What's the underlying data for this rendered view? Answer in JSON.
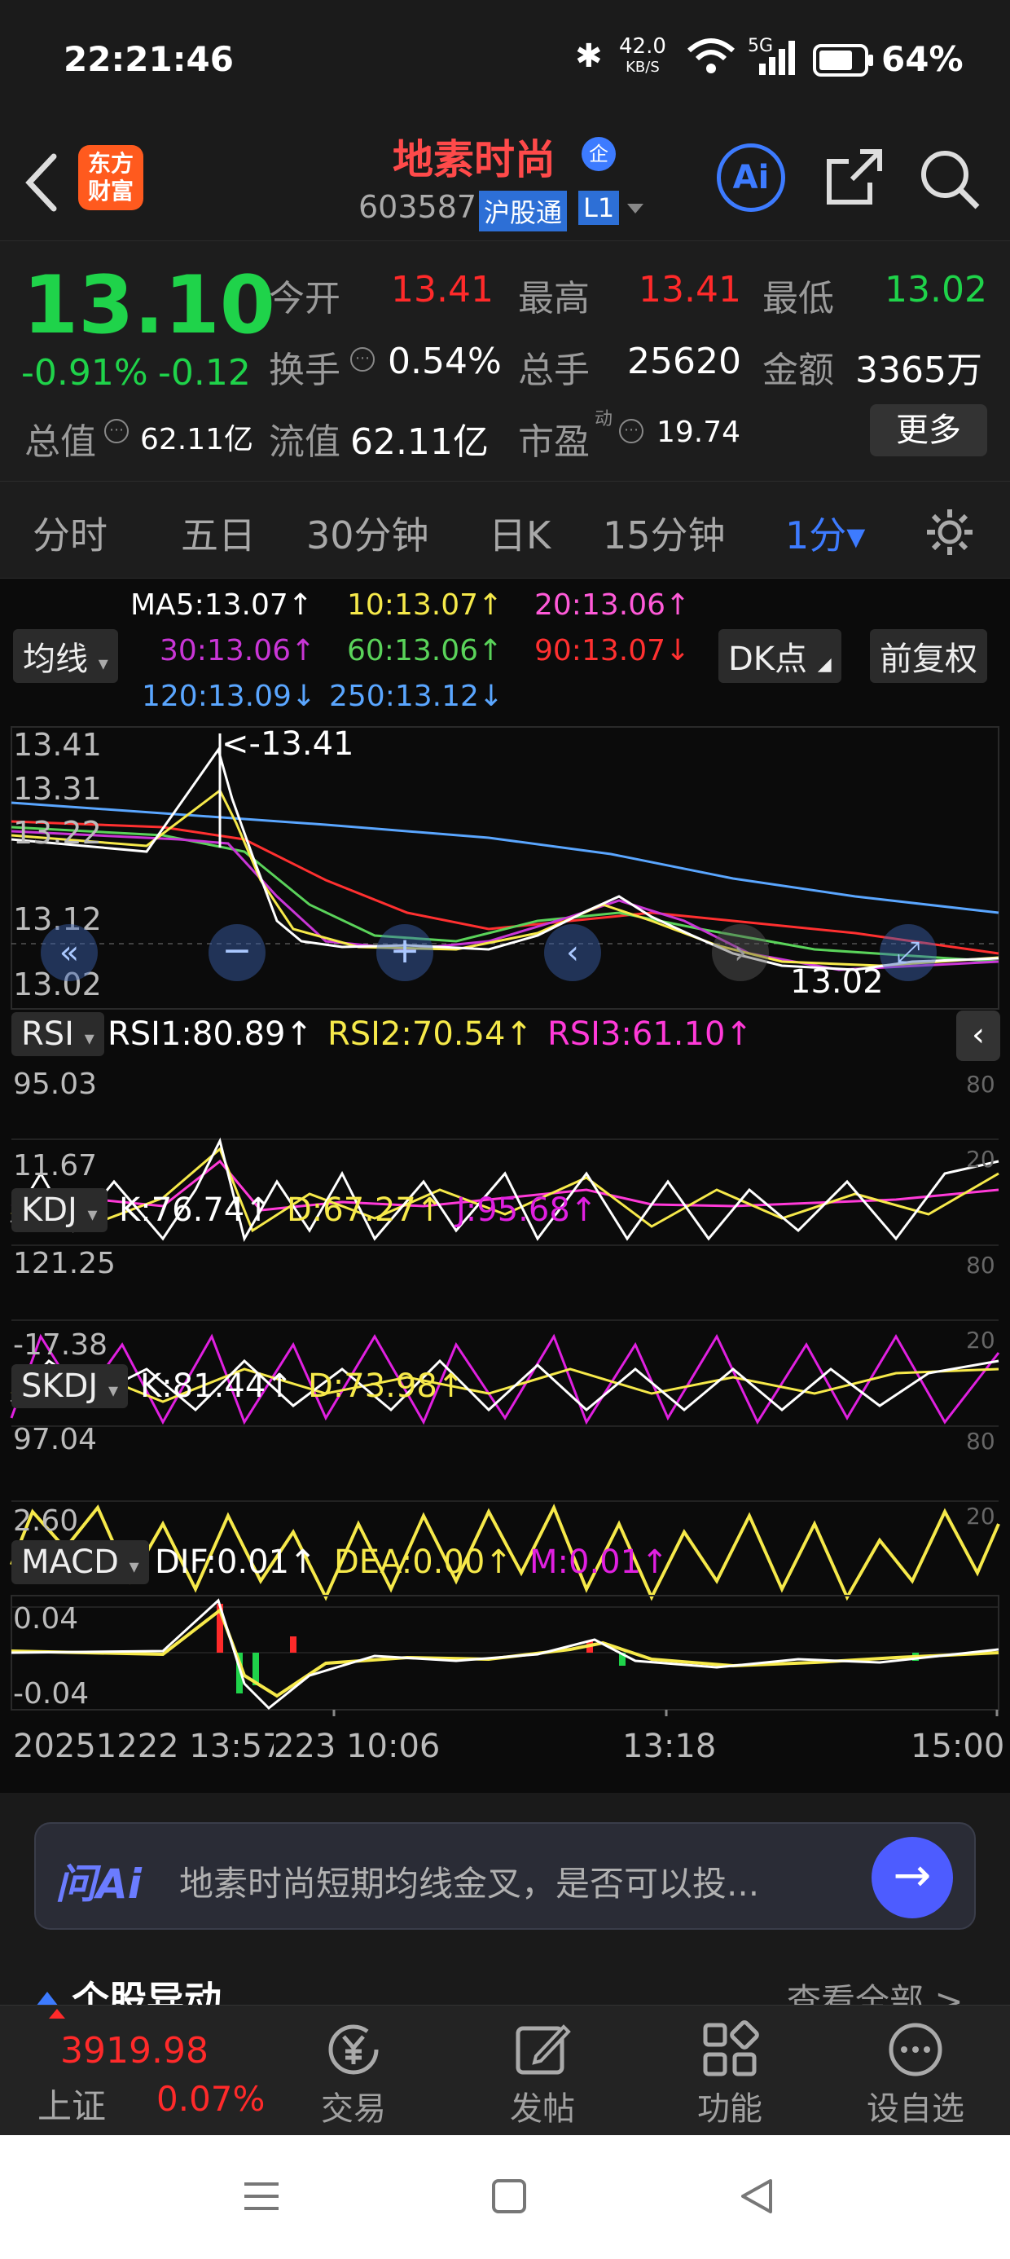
{
  "status_bar": {
    "time": "22:21:46",
    "net_speed_top": "42.0",
    "net_speed_bottom": "KB/S",
    "network": "5G",
    "battery": "64%"
  },
  "header": {
    "logo_line1": "东方",
    "logo_line2": "财富",
    "title": "地素时尚",
    "badge": "企",
    "code": "603587",
    "market_tag": "沪股通",
    "level_tag": "L1",
    "ai_label": "Ai"
  },
  "quote": {
    "price": "13.10",
    "change_pct": "-0.91%",
    "change": "-0.12",
    "open_label": "今开",
    "open": "13.41",
    "high_label": "最高",
    "high": "13.41",
    "low_label": "最低",
    "low": "13.02",
    "turnover_label": "换手",
    "turnover": "0.54%",
    "volume_label": "总手",
    "volume": "25620",
    "amount_label": "金额",
    "amount": "3365万",
    "mktcap_label": "总值",
    "mktcap": "62.11亿",
    "float_label": "流值",
    "float_cap": "62.11亿",
    "pe_label": "市盈",
    "pe_sup": "动",
    "pe": "19.74",
    "more_button": "更多"
  },
  "tabs": [
    "分时",
    "五日",
    "30分钟",
    "日K",
    "15分钟",
    "1分▾"
  ],
  "ma_legend": {
    "selector": "均线",
    "ma5": "MA5:13.07↑",
    "ma10": "10:13.07↑",
    "ma20": "20:13.06↑",
    "ma30": "30:13.06↑",
    "ma60": "60:13.06↑",
    "ma90": "90:13.07↓",
    "ma120": "120:13.09↓",
    "ma250": "250:13.12↓",
    "dk_button": "DK点",
    "adjust_button": "前复权"
  },
  "price_axis": [
    "13.41",
    "13.31",
    "13.22",
    "13.12",
    "13.02"
  ],
  "price_annotations": {
    "high": "<-13.41",
    "low": "13.02"
  },
  "rsi": {
    "selector": "RSI",
    "rsi1": "RSI1:80.89↑",
    "rsi2": "RSI2:70.54↑",
    "rsi3": "RSI3:61.10↑",
    "max": "95.03",
    "min": "11.67",
    "ref_hi": "80",
    "ref_lo": "20"
  },
  "kdj": {
    "selector": "KDJ",
    "k": "K:76.74↑",
    "d": "D:67.27↑",
    "j": "J:95.68↑",
    "max": "121.25",
    "min": "-17.38",
    "ref_hi": "80",
    "ref_lo": "20"
  },
  "skdj": {
    "selector": "SKDJ",
    "k": "K:81.44↑",
    "d": "D:73.98↑",
    "max": "97.04",
    "min": "2.60",
    "ref_hi": "80",
    "ref_lo": "20"
  },
  "macd": {
    "selector": "MACD",
    "dif": "DIF:0.01↑",
    "dea": "DEA:0.00↑",
    "m": "M:0.01↑",
    "max": "0.04",
    "min": "-0.04"
  },
  "time_axis": [
    "20251222 13:57",
    "223 10:06",
    "13:18",
    "15:00"
  ],
  "ai_bar": {
    "label": "问Ai",
    "prompt": "地素时尚短期均线金叉，是否可以投..."
  },
  "section_peek": {
    "title": "个股异动",
    "link": "查看全部 >"
  },
  "bottom_nav": {
    "index_value": "3919.98",
    "index_name": "上证",
    "index_change": "0.07%",
    "items": [
      "交易",
      "发帖",
      "功能",
      "设自选"
    ]
  },
  "colors": {
    "up": "#ff2a2a",
    "down": "#1fd34a",
    "accent": "#3d7bff",
    "yellow": "#f6e94a",
    "magenta": "#e020e0"
  }
}
